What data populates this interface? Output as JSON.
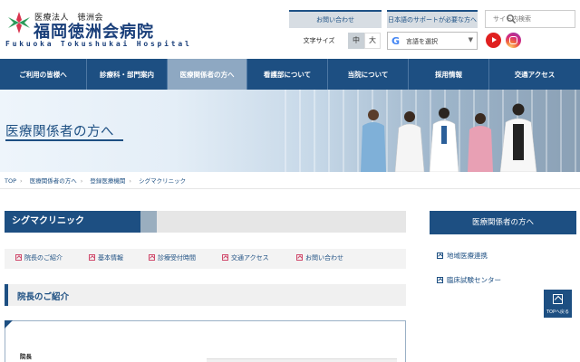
{
  "header": {
    "logo_sub": "医療法人　徳洲会",
    "logo_main": "福岡徳洲会病院",
    "logo_en": "Fukuoka Tokushukai Hospital",
    "contact_label": "お問い合わせ",
    "jp_support_label": "日本語のサポートが必要な方へ",
    "search_placeholder": "サイト内検索",
    "fontsize_label": "文字サイズ",
    "fontsize_mid": "中",
    "fontsize_large": "大",
    "lang_select_label": "言語を選択",
    "colors": {
      "brand": "#1d4f82",
      "youtube": "#e02020"
    }
  },
  "nav": {
    "items": [
      {
        "label": "ご利用の皆様へ"
      },
      {
        "label": "診療科・部門案内"
      },
      {
        "label": "医療関係者の方へ",
        "active": true
      },
      {
        "label": "看護部について"
      },
      {
        "label": "当院について"
      },
      {
        "label": "採用情報"
      },
      {
        "label": "交通アクセス"
      }
    ]
  },
  "hero": {
    "title": "医療関係者の方へ"
  },
  "breadcrumb": {
    "items": [
      "TOP",
      "医療関係者の方へ",
      "登録医療機関",
      "シグマクリニック"
    ]
  },
  "main": {
    "clinic_title": "シグマクリニック",
    "anchors": [
      "院長のご紹介",
      "基本情報",
      "診療受付時間",
      "交通アクセス",
      "お問い合わせ"
    ],
    "section_title": "院長のご紹介",
    "info_label": "院長"
  },
  "sidebar": {
    "heading": "医療関係者の方へ",
    "items": [
      "地域医療連携",
      "臨床試験センター"
    ]
  },
  "to_top_label": "TOPへ戻る"
}
